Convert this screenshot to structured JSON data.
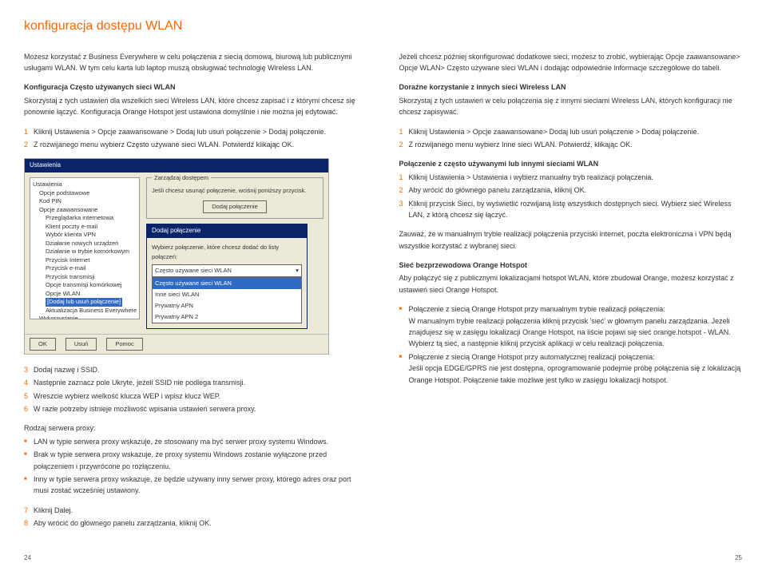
{
  "title": "konfiguracja dostępu WLAN",
  "intro": "Możesz korzystać z Business Everywhere w celu połączenia z siecią domową, biurową lub publicznymi usługami WLAN. W tym celu karta lub laptop muszą obsługiwać technologię Wireless LAN.",
  "freq": {
    "head": "Konfiguracja Często używanych sieci WLAN",
    "body": "Skorzystaj z tych ustawień dla wszelkich sieci Wireless LAN, które chcesz zapisać i z którymi chcesz się ponownie łączyć. Konfiguracja Orange Hotspot jest ustawiona domyślnie i nie można jej edytować."
  },
  "steps_left1": [
    "Kliknij Ustawienia > Opcje zaawansowane > Dodaj lub usuń połączenie > Dodaj połączenie.",
    "Z rozwijanego menu wybierz Często używane sieci WLAN. Potwierdź klikając OK."
  ],
  "screenshot": {
    "win_title": "Ustawienia",
    "tree": [
      "Ustawienia",
      "  Opcje podstawowe",
      "  Kod PIN",
      "  Opcje zaawansowane",
      "    Przeglądarka internetowa",
      "    Klient poczty e-mail",
      "    Wybór klienta VPN",
      "    Działanie nowych urządzeń",
      "    Działanie w trybie komórkowym",
      "      Przycisk Internet",
      "      Przycisk e-mail",
      "      Przycisk transmisji",
      "    Opcje transmisji komórkowej",
      "    Opcje WLAN",
      "    [Dodaj lub usuń połączenie]",
      "    Aktualizacja Business Everywhere",
      "  Wykorzystanie"
    ],
    "group_legend": "Zarządzaj dostępem",
    "group_text": "Jeśli chcesz usunąć połączenie, wciśnij poniższy przycisk.",
    "btn_add": "Dodaj połączenie",
    "dialog_title": "Dodaj połączenie",
    "dialog_text": "Wybierz połączenie, które chcesz dodać do listy połączeń:",
    "dropdown_sel": "Często używane sieci WLAN",
    "dropdown_items": [
      "Często używane sieci WLAN",
      "Inne sieci WLAN",
      "Prywatny APN",
      "Prywatny APN 2"
    ],
    "btns": [
      "OK",
      "Usuń",
      "Pomoc"
    ]
  },
  "steps_left2": [
    "Dodaj nazwę i SSID.",
    "Następnie zaznacz pole Ukryte, jeżeli SSID nie podlega transmisji.",
    "Wreszcie wybierz wielkość klucza WEP i wpisz klucz WEP.",
    "W razie potrzeby istnieje możliwość wpisania ustawień serwera proxy."
  ],
  "proxy_label": "Rodzaj serwera proxy:",
  "proxy_bullets": [
    "LAN w typie serwera proxy wskazuje, że stosowany ma być serwer proxy systemu Windows.",
    "Brak w typie serwera proxy wskazuje, że proxy systemu Windows zostanie wyłączone przed połączeniem i przywrócone po rozłączeniu.",
    "Inny w typie serwera proxy wskazuje, że będzie używany inny serwer proxy, którego adres oraz port musi zostać wcześniej ustawiony."
  ],
  "steps_left3": [
    "Kliknij Dalej.",
    "Aby wrócić do głównego panelu zarządzania, kliknij OK."
  ],
  "right_intro": "Jeżeli chcesz później skonfigurować dodatkowe sieci, możesz to zrobić, wybierając Opcje zaawansowane> Opcje WLAN> Często używane sieci WLAN i dodając odpowiednie informacje szczegółowe do tabeli.",
  "adhoc": {
    "head": "Doraźne korzystanie z innych sieci Wireless LAN",
    "body": "Skorzystaj z tych ustawień w celu połączenia się z innymi sieciami Wireless LAN, których konfiguracji nie chcesz zapisywać."
  },
  "steps_right1": [
    "Kliknij Ustawienia > Opcje zaawansowane> Dodaj lub usuń połączenie > Dodaj połączenie.",
    "Z rozwijanego menu wybierz Inne sieci WLAN. Potwierdź, klikając OK."
  ],
  "conn_head": "Połączenie z często używanymi lub innymi sieciami WLAN",
  "steps_right2": [
    "Kliknij Ustawienia > Ustawienia i wybierz manualny tryb realizacji połączenia.",
    "Aby wrócić do głównego panelu zarządzania, kliknij OK.",
    "Kliknij przycisk Sieci, by wyświetlić rozwijaną listę wszystkich dostępnych sieci. Wybierz sieć Wireless LAN, z którą chcesz się łączyć."
  ],
  "note": "Zauważ, że w manualnym trybie realizacji połączenia przyciski internet, poczta elektroniczna i VPN będą wszystkie korzystać z wybranej sieci.",
  "hotspot": {
    "head": "Sieć bezprzewodowa Orange Hotspot",
    "body": "Aby połączyć się z publicznymi lokalizacjami hotspot WLAN, które zbudował Orange, możesz korzystać z ustawień sieci Orange Hotspot."
  },
  "hotspot_bullets": [
    "Połączenie z siecią Orange Hotspot przy manualnym trybie realizacji połączenia:\nW manualnym trybie realizacji połączenia kliknij przycisk 'sieć' w głównym panelu zarządzania. Jeżeli znajdujesz się w zasięgu lokalizacji Orange Hotspot, na liście pojawi się sieć orange.hotspot - WLAN. Wybierz tą sieć, a następnie kliknij przycisk aplikacji w celu realizacji połączenia.",
    "Połączenie z siecią Orange Hotspot przy automatycznej realizacji połączenia:\nJeśli opcja EDGE/GPRS nie jest dostępna, oprogramowanie podejmie próbę połączenia się z lokalizacją Orange Hotspot. Połączenie takie możliwe jest tylko w zasięgu lokalizacji hotspot."
  ],
  "page_left": "24",
  "page_right": "25"
}
